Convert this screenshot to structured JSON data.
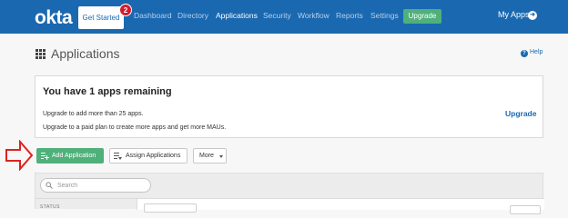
{
  "nav": {
    "logo": "okta",
    "get_started": "Get Started",
    "badge_count": "2",
    "links": [
      "Dashboard",
      "Directory",
      "Applications",
      "Security",
      "Workflow",
      "Reports",
      "Settings"
    ],
    "upgrade": "Upgrade",
    "my_apps": "My Apps"
  },
  "page": {
    "title": "Applications",
    "help": "Help"
  },
  "card": {
    "title": "You have 1 apps remaining",
    "line1": "Upgrade to add more than 25 apps.",
    "line2": "Upgrade to a paid plan to create more apps and get more MAUs.",
    "upgrade_link": "Upgrade"
  },
  "actions": {
    "add_application": "Add Application",
    "assign_applications": "Assign Applications",
    "more": "More"
  },
  "search": {
    "placeholder": "Search"
  },
  "sidebar": {
    "status_label": "STATUS"
  },
  "colors": {
    "nav_bg": "#1a68b0",
    "accent_green": "#4fb07a",
    "badge_red": "#d51a2b",
    "arrow_red": "#e02020"
  }
}
